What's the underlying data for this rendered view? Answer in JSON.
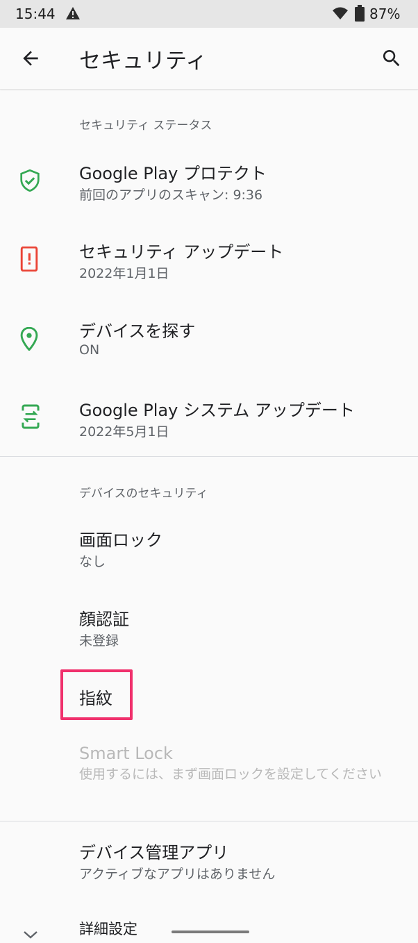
{
  "status_bar": {
    "time": "15:44",
    "battery": "87%"
  },
  "app_bar": {
    "title": "セキュリティ"
  },
  "sections": {
    "status": {
      "header": "セキュリティ ステータス",
      "items": [
        {
          "title": "Google Play プロテクト",
          "subtitle": "前回のアプリのスキャン: 9:36",
          "icon": "shield-check-icon"
        },
        {
          "title": "セキュリティ アップデート",
          "subtitle": "2022年1月1日",
          "icon": "phone-alert-icon"
        },
        {
          "title": "デバイスを探す",
          "subtitle": "ON",
          "icon": "location-pin-icon"
        },
        {
          "title": "Google Play システム アップデート",
          "subtitle": "2022年5月1日",
          "icon": "system-update-icon"
        }
      ]
    },
    "device": {
      "header": "デバイスのセキュリティ",
      "items": [
        {
          "title": "画面ロック",
          "subtitle": "なし"
        },
        {
          "title": "顔認証",
          "subtitle": "未登録"
        },
        {
          "title": "指紋"
        },
        {
          "title": "Smart Lock",
          "subtitle": "使用するには、まず画面ロックを設定してください"
        }
      ]
    },
    "admin": {
      "items": [
        {
          "title": "デバイス管理アプリ",
          "subtitle": "アクティブなアプリはありません"
        },
        {
          "title": "詳細設定"
        }
      ]
    }
  },
  "colors": {
    "accent_green": "#34a853",
    "alert_red": "#ea4335",
    "highlight": "#f0306c"
  }
}
